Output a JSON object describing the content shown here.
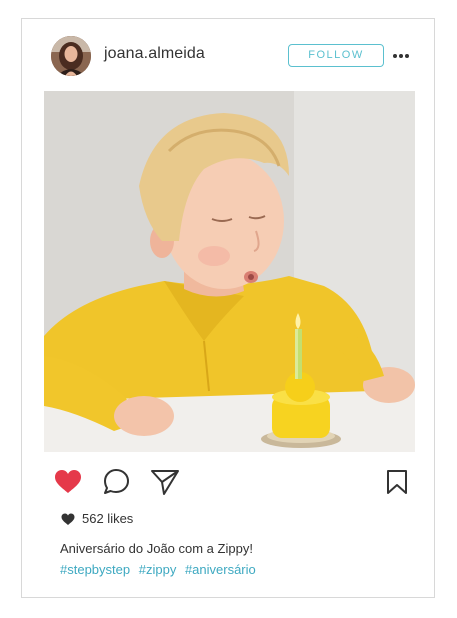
{
  "post": {
    "username": "joana.almeida",
    "follow_label": "FOLLOW",
    "likes_text": "562 likes",
    "caption": "Aniversário do João com a Zippy!",
    "hashtags": [
      "#stepbystep",
      "#zippy",
      "#aniversário"
    ]
  },
  "icons": {
    "like": "heart-icon",
    "comment": "comment-bubble-icon",
    "share": "send-paper-plane-icon",
    "save": "bookmark-icon",
    "more": "more-dots-icon",
    "likes_count": "heart-small-icon"
  },
  "colors": {
    "accent": "#5bc0cf",
    "hashtag": "#3ea9c1",
    "heart": "#e5394a",
    "text": "#333333",
    "border": "#d8d8d8"
  }
}
